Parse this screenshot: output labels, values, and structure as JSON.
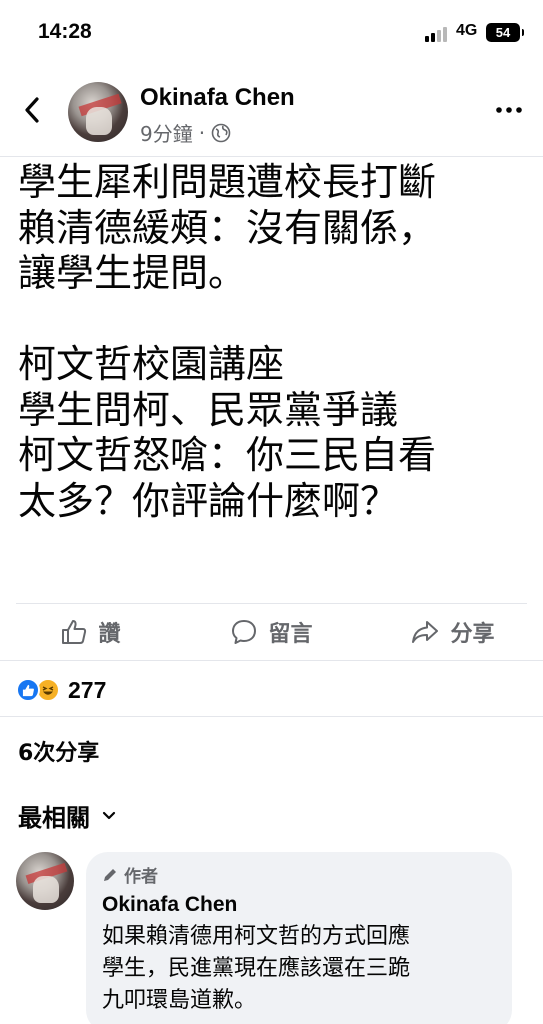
{
  "status_bar": {
    "time": "14:28",
    "network": "4G",
    "battery": "54"
  },
  "post": {
    "author": "Okinafa Chen",
    "time_ago": "9分鐘",
    "separator": "·",
    "privacy_icon": "globe-icon",
    "text": "學生犀利問題遭校長打斷\n賴清德緩頰：沒有關係，\n讓學生提問。\n\n柯文哲校園講座\n學生問柯、民眾黨爭議\n柯文哲怒嗆：你三民自看\n太多？你評論什麼啊？"
  },
  "actions": {
    "like": "讚",
    "comment": "留言",
    "share": "分享"
  },
  "reactions": {
    "count": "277",
    "types": [
      "like-icon",
      "haha-icon"
    ]
  },
  "shares": "6次分享",
  "sort": {
    "label": "最相關"
  },
  "comment": {
    "badge": "作者",
    "author": "Okinafa Chen",
    "text": "如果賴清德用柯文哲的方式回應\n學生，民進黨現在應該還在三跪\n九叩環島道歉。"
  },
  "colors": {
    "accent_blue": "#1877f2",
    "secondary_text": "#65676b",
    "comment_bg": "#f0f2f5",
    "haha_yellow": "#f7b125"
  }
}
